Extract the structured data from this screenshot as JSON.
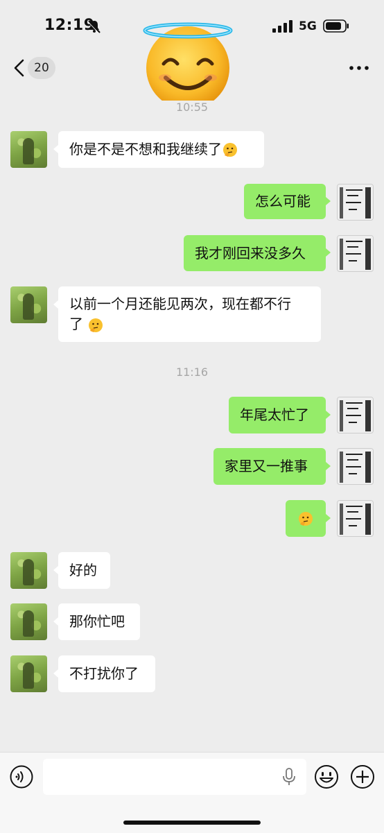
{
  "status": {
    "time": "12:19",
    "network": "5G"
  },
  "nav": {
    "unread_count": "20"
  },
  "messages": [
    {
      "timestamp": "10:55"
    },
    {
      "side": "left",
      "text": "你是不是不想和我继续了",
      "emoji": "thinking-face-icon"
    },
    {
      "side": "right",
      "text": "怎么可能"
    },
    {
      "side": "right",
      "text": "我才刚回来没多久"
    },
    {
      "side": "left",
      "text_line1": "以前一个月还能见两次，现在都不行",
      "text_line2": "了",
      "emoji": "thinking-face-icon"
    },
    {
      "timestamp": "11:16"
    },
    {
      "side": "right",
      "text": "年尾太忙了"
    },
    {
      "side": "right",
      "text": "家里又一推事"
    },
    {
      "side": "right",
      "emoji": "thinking-face-icon"
    },
    {
      "side": "left",
      "text": "好的"
    },
    {
      "side": "left",
      "text": "那你忙吧"
    },
    {
      "side": "left",
      "text": "不打扰你了"
    }
  ],
  "colors": {
    "background": "#ededed",
    "sent_bubble": "#95ec69",
    "received_bubble": "#ffffff"
  },
  "icons": {
    "overlay": "smiling-face-with-halo-icon"
  }
}
